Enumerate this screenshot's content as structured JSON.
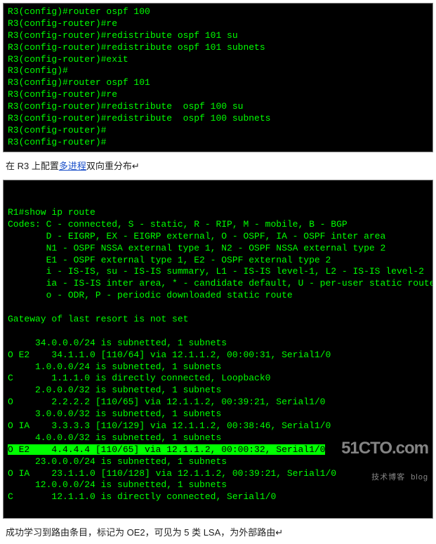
{
  "terminal1": {
    "lines": [
      "R3(config)#router ospf 100",
      "R3(config-router)#re",
      "R3(config-router)#redistribute ospf 101 su",
      "R3(config-router)#redistribute ospf 101 subnets",
      "R3(config-router)#exit",
      "R3(config)#",
      "R3(config)#router ospf 101",
      "R3(config-router)#re",
      "R3(config-router)#redistribute  ospf 100 su",
      "R3(config-router)#redistribute  ospf 100 subnets",
      "R3(config-router)#",
      "R3(config-router)#"
    ]
  },
  "caption1": {
    "pre": "在 R3 上配置",
    "link": "多进程",
    "post": "双向重分布",
    "arrow": "↵"
  },
  "terminal2": {
    "lines": [
      "R1#show ip route",
      "Codes: C - connected, S - static, R - RIP, M - mobile, B - BGP",
      "       D - EIGRP, EX - EIGRP external, O - OSPF, IA - OSPF inter area",
      "       N1 - OSPF NSSA external type 1, N2 - OSPF NSSA external type 2",
      "       E1 - OSPF external type 1, E2 - OSPF external type 2",
      "       i - IS-IS, su - IS-IS summary, L1 - IS-IS level-1, L2 - IS-IS level-2",
      "       ia - IS-IS inter area, * - candidate default, U - per-user static route",
      "       o - ODR, P - periodic downloaded static route",
      "",
      "Gateway of last resort is not set",
      "",
      "     34.0.0.0/24 is subnetted, 1 subnets",
      "O E2    34.1.1.0 [110/64] via 12.1.1.2, 00:00:31, Serial1/0",
      "     1.0.0.0/24 is subnetted, 1 subnets",
      "C       1.1.1.0 is directly connected, Loopback0",
      "     2.0.0.0/32 is subnetted, 1 subnets",
      "O       2.2.2.2 [110/65] via 12.1.1.2, 00:39:21, Serial1/0",
      "     3.0.0.0/32 is subnetted, 1 subnets",
      "O IA    3.3.3.3 [110/129] via 12.1.1.2, 00:38:46, Serial1/0",
      "     4.0.0.0/32 is subnetted, 1 subnets"
    ],
    "highlight": "O E2    4.4.4.4 [110/65] via 12.1.1.2, 00:00:32, Serial1/0",
    "lines_after": [
      "     23.0.0.0/24 is subnetted, 1 subnets",
      "O IA    23.1.1.0 [110/128] via 12.1.1.2, 00:39:21, Serial1/0",
      "     12.0.0.0/24 is subnetted, 1 subnets",
      "C       12.1.1.0 is directly connected, Serial1/0"
    ]
  },
  "watermark": {
    "main": "51CTO.com",
    "sub": "技术博客  blog"
  },
  "caption2": {
    "text": "成功学习到路由条目，标记为 OE2，可见为 5 类 LSA，为外部路由",
    "arrow": "↵"
  }
}
